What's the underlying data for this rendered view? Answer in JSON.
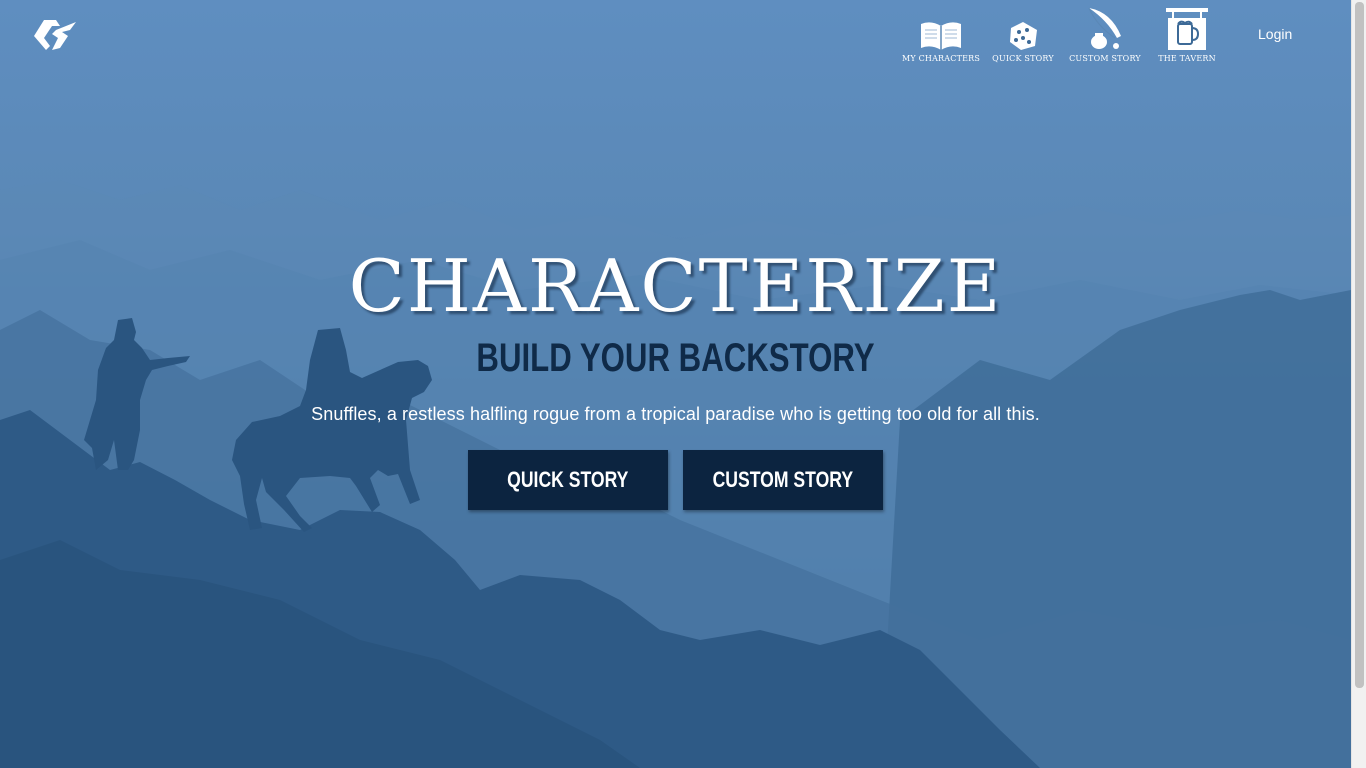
{
  "brand": {
    "logo_icon": "characterize-logo-icon"
  },
  "nav": {
    "items": [
      {
        "label": "My Characters",
        "icon": "open-book-icon"
      },
      {
        "label": "Quick Story",
        "icon": "dice-icon"
      },
      {
        "label": "Custom Story",
        "icon": "quill-inkwell-icon"
      },
      {
        "label": "The Tavern",
        "icon": "tavern-sign-icon"
      }
    ],
    "login_label": "Login"
  },
  "hero": {
    "title": "CHARACTERIZE",
    "subtitle": "BUILD YOUR BACKSTORY",
    "blurb": "Snuffles, a restless halfling rogue from a tropical paradise who is getting too old for all this.",
    "buttons": {
      "quick_label": "QUICK STORY",
      "custom_label": "CUSTOM STORY"
    }
  },
  "colors": {
    "sky": "#5f8ec0",
    "button_bg": "#0c2440",
    "subtitle_text": "#0f2a48",
    "text": "#ffffff"
  }
}
